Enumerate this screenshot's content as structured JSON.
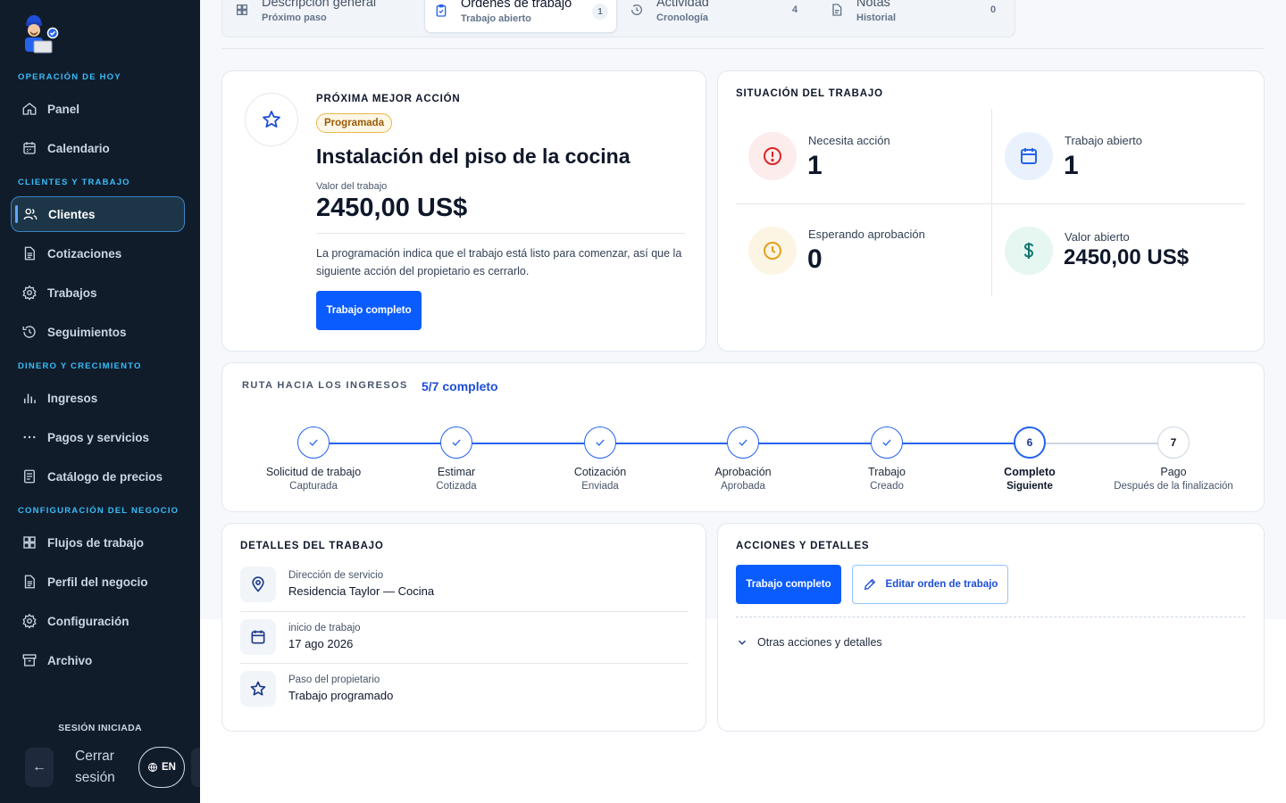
{
  "sidebar": {
    "sections": {
      "today": "OPERACIÓN DE HOY",
      "clients_work": "CLIENTES Y TRABAJO",
      "money": "DINERO Y CRECIMIENTO",
      "business": "CONFIGURACIÓN DEL NEGOCIO"
    },
    "items": [
      {
        "label": "Panel",
        "icon": "home-icon"
      },
      {
        "label": "Calendario",
        "icon": "calendar-icon"
      },
      {
        "label": "Clientes",
        "icon": "users-icon",
        "active": true
      },
      {
        "label": "Cotizaciones",
        "icon": "document-icon"
      },
      {
        "label": "Trabajos",
        "icon": "gear-icon"
      },
      {
        "label": "Seguimientos",
        "icon": "history-icon"
      },
      {
        "label": "Ingresos",
        "icon": "bar-chart-icon"
      },
      {
        "label": "Pagos y servicios",
        "icon": "dots-icon"
      },
      {
        "label": "Catálogo de precios",
        "icon": "list-icon"
      },
      {
        "label": "Flujos de trabajo",
        "icon": "grid-icon"
      },
      {
        "label": "Perfil del negocio",
        "icon": "document-icon"
      },
      {
        "label": "Configuración",
        "icon": "gear-icon"
      },
      {
        "label": "Archivo",
        "icon": "archive-icon"
      }
    ],
    "session_label": "SESIÓN INICIADA",
    "logout_label": "Cerrar sesión",
    "lang_label": "EN"
  },
  "tabs": [
    {
      "name": "Descripción general",
      "sub": "Próximo paso",
      "count": "",
      "icon": "grid-icon"
    },
    {
      "name": "Órdenes de trabajo",
      "sub": "Trabajo abierto",
      "count": "1",
      "icon": "clipboard-icon",
      "active": true
    },
    {
      "name": "Actividad",
      "sub": "Cronología",
      "count": "4",
      "icon": "clock-icon"
    },
    {
      "name": "Notas",
      "sub": "Historial",
      "count": "0",
      "icon": "note-icon"
    }
  ],
  "next_action": {
    "title": "PRÓXIMA MEJOR ACCIÓN",
    "badge": "Programada",
    "job_name": "Instalación del piso de la cocina",
    "value_label": "Valor del trabajo",
    "value": "2450,00 US$",
    "description": "La programación indica que el trabajo está listo para comenzar, así que la siguiente acción del propietario es cerrarlo.",
    "button": "Trabajo completo"
  },
  "status": {
    "title": "SITUACIÓN DEL TRABAJO",
    "cells": [
      {
        "label": "Necesita acción",
        "value": "1"
      },
      {
        "label": "Trabajo abierto",
        "value": "1"
      },
      {
        "label": "Esperando aprobación",
        "value": "0"
      },
      {
        "label": "Valor abierto",
        "value": "2450,00 US$"
      }
    ]
  },
  "route": {
    "title": "RUTA HACIA LOS INGRESOS",
    "progress": "5/7 completo",
    "steps": [
      {
        "name": "Solicitud de trabajo",
        "sub": "Capturada",
        "state": "done"
      },
      {
        "name": "Estimar",
        "sub": "Cotizada",
        "state": "done"
      },
      {
        "name": "Cotización",
        "sub": "Enviada",
        "state": "done"
      },
      {
        "name": "Aprobación",
        "sub": "Aprobada",
        "state": "done"
      },
      {
        "name": "Trabajo",
        "sub": "Creado",
        "state": "done"
      },
      {
        "name": "Completo",
        "sub": "Siguiente",
        "state": "current",
        "number": "6"
      },
      {
        "name": "Pago",
        "sub": "Después de la finalización",
        "state": "future",
        "number": "7"
      }
    ]
  },
  "details": {
    "title": "DETALLES DEL TRABAJO",
    "rows": [
      {
        "label": "Dirección de servicio",
        "value": "Residencia Taylor — Cocina"
      },
      {
        "label": "inicio de trabajo",
        "value": "17 ago 2026"
      },
      {
        "label": "Paso del propietario",
        "value": "Trabajo programado"
      }
    ]
  },
  "actions": {
    "title": "ACCIONES Y DETALLES",
    "primary": "Trabajo completo",
    "secondary": "Editar orden de trabajo",
    "more": "Otras acciones y detalles"
  },
  "colors": {
    "sidebar_bg": "#111c2b",
    "accent": "#0b5cff",
    "section_label": "#38bdf8"
  }
}
